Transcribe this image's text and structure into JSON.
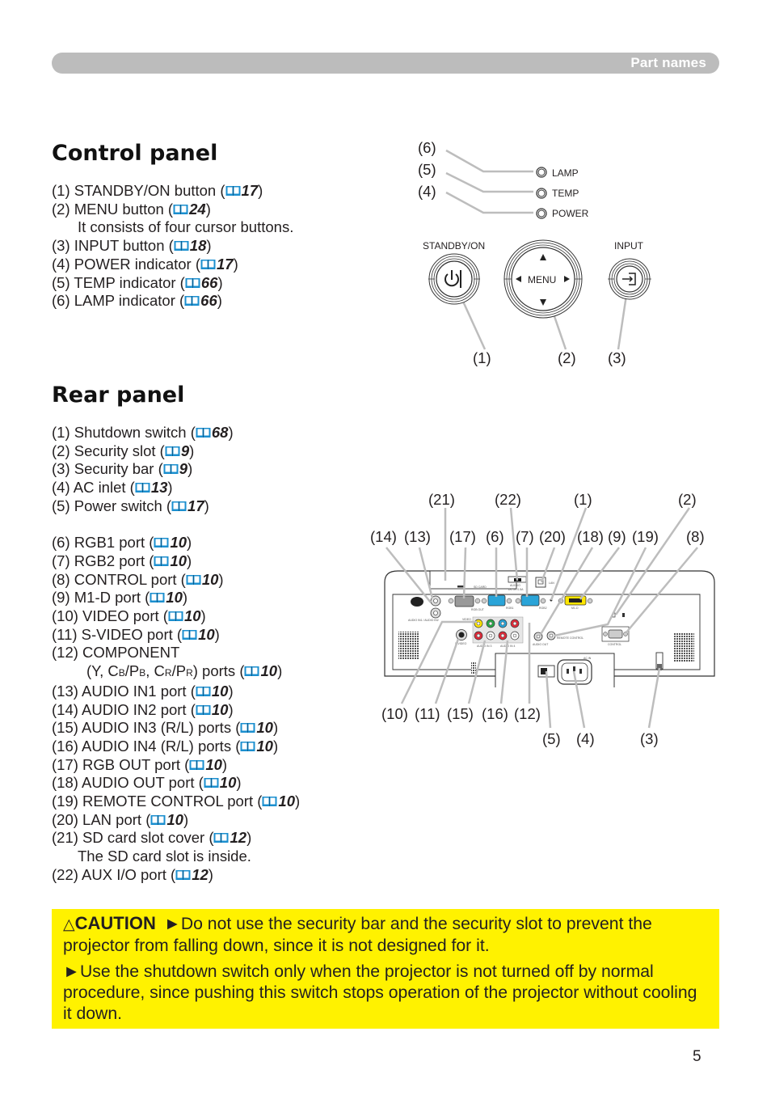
{
  "header": {
    "section_label": "Part names"
  },
  "control_panel": {
    "title": "Control panel",
    "items": [
      {
        "num": "(1)",
        "text": "STANDBY/ON button (",
        "ref": "17",
        "close": ")"
      },
      {
        "num": "(2)",
        "text": "MENU button (",
        "ref": "24",
        "close": ")"
      },
      {
        "continuation": "It consists of four cursor buttons."
      },
      {
        "num": "(3)",
        "text": "INPUT button (",
        "ref": "18",
        "close": ")"
      },
      {
        "num": "(4)",
        "text": "POWER indicator (",
        "ref": "17",
        "close": ")"
      },
      {
        "num": "(5)",
        "text": "TEMP indicator (",
        "ref": "66",
        "close": ")"
      },
      {
        "num": "(6)",
        "text": "LAMP indicator (",
        "ref": "66",
        "close": ")"
      }
    ],
    "diagram": {
      "indicators": [
        "LAMP",
        "TEMP",
        "POWER"
      ],
      "buttons": {
        "standby": "STANDBY/ON",
        "menu": "MENU",
        "input": "INPUT"
      },
      "callouts": [
        "(6)",
        "(5)",
        "(4)",
        "(1)",
        "(2)",
        "(3)"
      ]
    }
  },
  "rear_panel": {
    "title": "Rear panel",
    "items": [
      {
        "num": "(1)",
        "text": "Shutdown switch (",
        "ref": "68",
        "close": ")"
      },
      {
        "num": "(2)",
        "text": "Security slot (",
        "ref": "9",
        "close": ")"
      },
      {
        "num": "(3)",
        "text": "Security bar (",
        "ref": "9",
        "close": ")"
      },
      {
        "num": "(4)",
        "text": "AC inlet (",
        "ref": "13",
        "close": ")"
      },
      {
        "num": "(5)",
        "text": "Power switch (",
        "ref": "17",
        "close": ")"
      },
      {
        "num": "(6)",
        "text": "RGB1 port (",
        "ref": "10",
        "close": ")"
      },
      {
        "num": "(7)",
        "text": "RGB2 port (",
        "ref": "10",
        "close": ")"
      },
      {
        "num": "(8)",
        "text": "CONTROL port (",
        "ref": "10",
        "close": ")"
      },
      {
        "num": "(9)",
        "text": "M1-D port (",
        "ref": "10",
        "close": ")"
      },
      {
        "num": "(10)",
        "text": "VIDEO port (",
        "ref": "10",
        "close": ")"
      },
      {
        "num": "(11)",
        "text": "S-VIDEO port (",
        "ref": "10",
        "close": ")"
      },
      {
        "num": "(12)",
        "text": "COMPONENT"
      },
      {
        "continuation_parts": [
          "(Y, C",
          "B",
          "/P",
          "B",
          ", C",
          "R",
          "/P",
          "R",
          ") ports ("
        ],
        "ref": "10",
        "close": ")"
      },
      {
        "num": "(13)",
        "text": "AUDIO IN1 port (",
        "ref": "10",
        "close": ")"
      },
      {
        "num": "(14)",
        "text": "AUDIO IN2 port (",
        "ref": "10",
        "close": ")"
      },
      {
        "num": "(15)",
        "text": "AUDIO IN3 (R/L) ports (",
        "ref": "10",
        "close": ")"
      },
      {
        "num": "(16)",
        "text": "AUDIO IN4 (R/L) ports (",
        "ref": "10",
        "close": ")"
      },
      {
        "num": "(17)",
        "text": "RGB OUT port (",
        "ref": "10",
        "close": ")"
      },
      {
        "num": "(18)",
        "text": "AUDIO OUT port (",
        "ref": "10",
        "close": ")"
      },
      {
        "num": "(19)",
        "text": "REMOTE CONTROL port (",
        "ref": "10",
        "close": ")"
      },
      {
        "num": "(20)",
        "text": "LAN port (",
        "ref": "10",
        "close": ")"
      },
      {
        "num": "(21)",
        "text": "SD card slot cover (",
        "ref": "12",
        "close": ")"
      },
      {
        "continuation": "The SD card slot is inside."
      },
      {
        "num": "(22)",
        "text": "AUX I/O port (",
        "ref": "12",
        "close": ")"
      }
    ],
    "diagram": {
      "callouts_top_row1": [
        "(21)",
        "(22)",
        "(1)",
        "(2)"
      ],
      "callouts_top_row2": [
        "(14)",
        "(13)",
        "(17)",
        "(6)",
        "(7)",
        "(20)",
        "(18)",
        "(9)",
        "(19)",
        "(8)"
      ],
      "callouts_bottom_row1": [
        "(10)",
        "(11)",
        "(15)",
        "(16)",
        "(12)"
      ],
      "callouts_bottom_row2": [
        "(5)",
        "(4)",
        "(3)"
      ],
      "panel_labels": {
        "sd_card": "SD CARD",
        "aux_io": "AUX I/O",
        "aux_io_spec": "DC 5V 0.5A",
        "lan": "LAN",
        "rgb_out": "RGB OUT",
        "rgb1": "RGB1",
        "rgb2": "RGB2",
        "m1d": "M1-D",
        "audio_in1_in2": "AUDIO IN1 / AUDIO IN2",
        "video": "VIDEO",
        "s_video": "S-VIDEO",
        "audio_in3": "AUDIO IN 3",
        "audio_in4": "AUDIO IN 4",
        "audio_out": "AUDIO OUT",
        "remote_control": "REMOTE CONTROL",
        "control": "CONTROL",
        "ac_in": "AC IN",
        "y": "Y",
        "cb_pb": "CB/PB",
        "cr_pr": "CR/PR"
      },
      "port_colors": {
        "video": "#ffe600",
        "y": "#2aa84a",
        "cb": "#2aa4d8",
        "cr": "#e02b3a",
        "rgb": "#2aa4d8",
        "m1d": "#ffe600"
      }
    }
  },
  "caution": {
    "icon": "warning-triangle-icon",
    "label": "CAUTION",
    "bullet": "►",
    "paragraph1": "Do not use the security bar and the security slot to prevent the projector from falling down, since it is not designed for it.",
    "paragraph2": "Use the shutdown switch only when the projector is not turned off by normal procedure, since pushing this switch stops operation of the projector without cooling it down.",
    "background": "#fff200"
  },
  "page_number": "5",
  "colors": {
    "header_bar": "#bcbcbc",
    "book_icon": "#1b8fcf",
    "leader_line": "#bdbdbd"
  }
}
